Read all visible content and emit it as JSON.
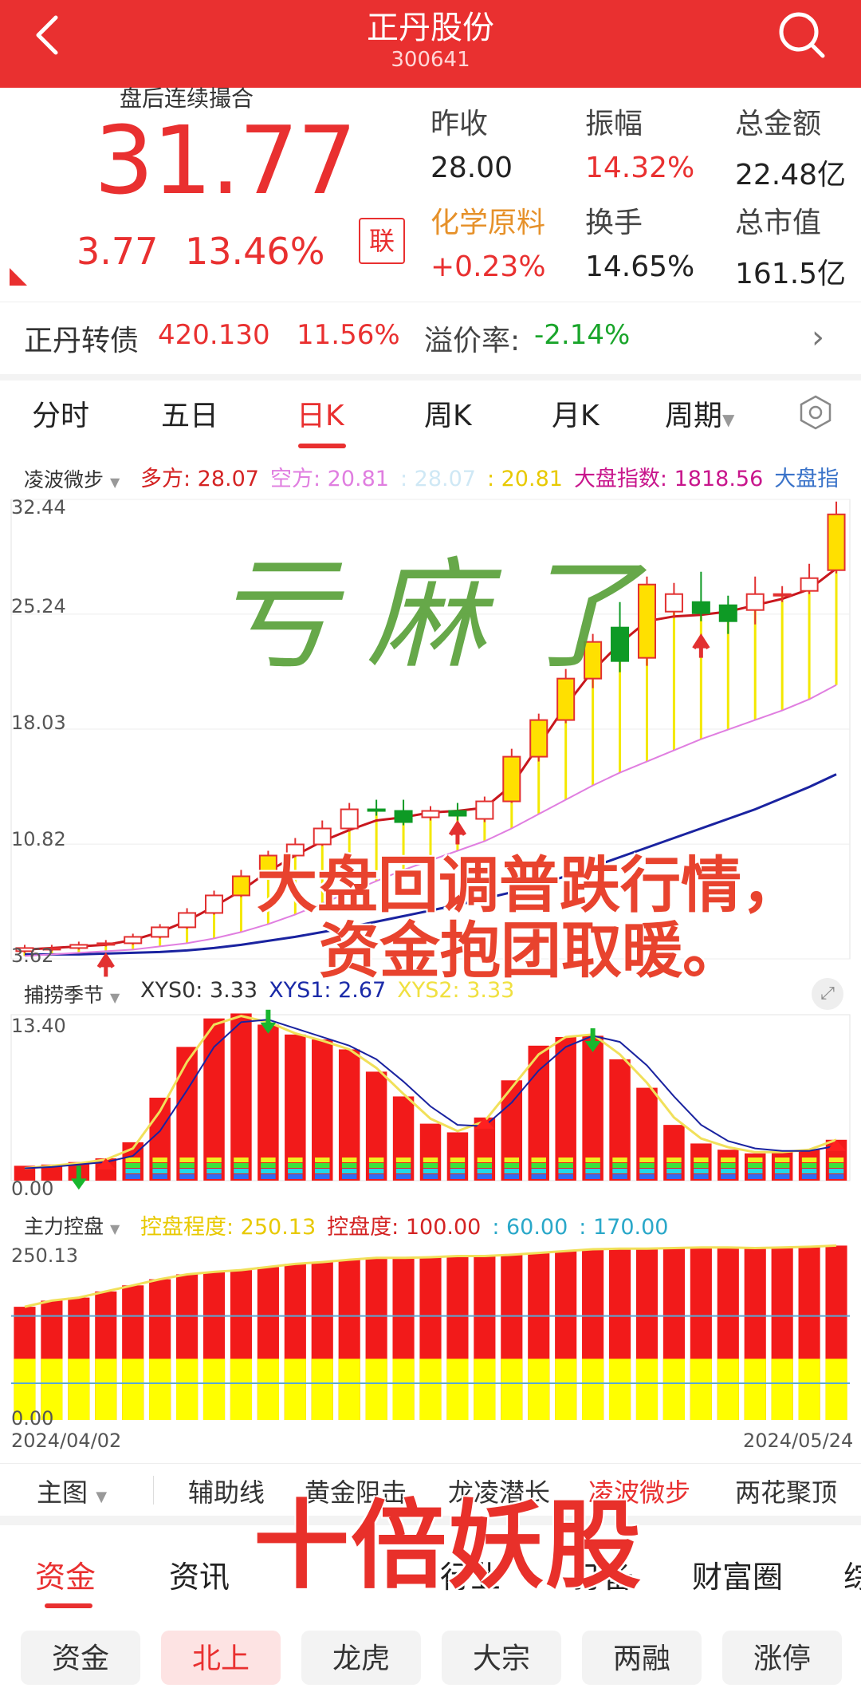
{
  "header": {
    "title": "正丹股份",
    "code": "300641"
  },
  "quote": {
    "status": "盘后连续撮合",
    "price": "31.77",
    "change": "3.77",
    "change_pct": "13.46%",
    "link_badge": "联",
    "fields": [
      {
        "label": "昨收",
        "value": "28.00",
        "color": "#222222"
      },
      {
        "label": "振幅",
        "value": "14.32%",
        "color": "#e93030"
      },
      {
        "label": "总金额",
        "value": "22.48亿",
        "color": "#222222"
      },
      {
        "label": "化学原料",
        "value": "+0.23%",
        "color": "#e93030"
      },
      {
        "label": "换手",
        "value": "14.65%",
        "color": "#222222"
      },
      {
        "label": "总市值",
        "value": "161.5亿",
        "color": "#222222"
      }
    ],
    "sector_label_color": "#e6912a"
  },
  "convertible": {
    "name": "正丹转债",
    "price": "420.130",
    "pct": "11.56%",
    "premium_label": "溢价率:",
    "premium_value": "-2.14%"
  },
  "period_tabs": [
    "分时",
    "五日",
    "日K",
    "周K",
    "月K",
    "周期"
  ],
  "main_indicator": {
    "name": "凌波微步",
    "items": [
      {
        "text": "多方: 28.07",
        "color": "#d42323"
      },
      {
        "text": "空方: 20.81",
        "color": "#e07ee0"
      },
      {
        "text": ": 28.07",
        "color": "#cfe8f5"
      },
      {
        "text": ": 20.81",
        "color": "#e8c900"
      },
      {
        "text": "大盘指数: 1818.56",
        "color": "#c8168c"
      },
      {
        "text": "大盘指",
        "color": "#3a73c9"
      }
    ]
  },
  "chart_data": [
    {
      "type": "candlestick",
      "title": "",
      "y_ticks": [
        "32.44",
        "25.24",
        "18.03",
        "10.82",
        "3.62"
      ],
      "ylim": [
        3.62,
        32.44
      ],
      "candles": [
        [
          4.1,
          4.3,
          4.5,
          4.0
        ],
        [
          4.3,
          4.3,
          4.5,
          4.1
        ],
        [
          4.3,
          4.5,
          4.7,
          4.2
        ],
        [
          4.5,
          4.6,
          4.8,
          4.4
        ],
        [
          4.6,
          5.0,
          5.2,
          4.5
        ],
        [
          5.0,
          5.6,
          5.8,
          4.9
        ],
        [
          5.6,
          6.5,
          6.8,
          5.5
        ],
        [
          6.5,
          7.6,
          7.9,
          6.4
        ],
        [
          7.6,
          8.8,
          9.2,
          7.5
        ],
        [
          8.8,
          10.1,
          10.4,
          8.6
        ],
        [
          10.1,
          10.8,
          11.2,
          10.0
        ],
        [
          10.8,
          11.8,
          12.3,
          10.7
        ],
        [
          11.8,
          13.0,
          13.4,
          11.6
        ],
        [
          13.0,
          12.9,
          13.6,
          12.6
        ],
        [
          12.9,
          12.2,
          13.6,
          12.0
        ],
        [
          12.5,
          12.9,
          13.2,
          12.3
        ],
        [
          12.9,
          12.6,
          13.4,
          12.3
        ],
        [
          12.4,
          13.5,
          13.8,
          12.2
        ],
        [
          13.5,
          16.3,
          16.8,
          13.4
        ],
        [
          16.3,
          18.6,
          19.0,
          16.0
        ],
        [
          18.6,
          21.2,
          21.8,
          18.4
        ],
        [
          21.2,
          23.5,
          24.0,
          20.6
        ],
        [
          24.4,
          22.3,
          26.0,
          21.6
        ],
        [
          22.5,
          27.1,
          27.6,
          22.0
        ],
        [
          25.4,
          26.5,
          27.2,
          25.0
        ],
        [
          26.0,
          25.3,
          27.9,
          24.8
        ],
        [
          25.8,
          24.8,
          26.4,
          24.0
        ],
        [
          25.5,
          26.5,
          27.6,
          24.6
        ],
        [
          26.5,
          26.5,
          27.0,
          26.0
        ],
        [
          26.7,
          27.5,
          28.4,
          26.5
        ],
        [
          28.0,
          31.5,
          32.3,
          27.8
        ]
      ],
      "red_line": [
        4.2,
        4.3,
        4.4,
        4.5,
        4.8,
        5.3,
        6.0,
        6.9,
        7.9,
        9.1,
        10.1,
        11.0,
        11.7,
        12.3,
        12.5,
        12.8,
        12.9,
        13.1,
        14.5,
        17.0,
        19.5,
        21.7,
        23.4,
        24.8,
        25.1,
        25.2,
        25.4,
        25.8,
        26.2,
        26.8,
        28.1
      ],
      "pink_line": [
        3.8,
        3.9,
        4.0,
        4.1,
        4.2,
        4.4,
        4.6,
        4.9,
        5.3,
        5.8,
        6.4,
        7.1,
        7.8,
        8.5,
        9.2,
        9.8,
        10.4,
        11.0,
        11.8,
        12.7,
        13.6,
        14.5,
        15.3,
        16.0,
        16.7,
        17.4,
        18.0,
        18.6,
        19.2,
        19.9,
        20.8
      ],
      "navy_line": [
        3.9,
        3.9,
        3.9,
        3.95,
        4.0,
        4.05,
        4.15,
        4.3,
        4.5,
        4.75,
        5.0,
        5.3,
        5.6,
        5.95,
        6.3,
        6.65,
        7.0,
        7.4,
        7.8,
        8.3,
        8.8,
        9.4,
        10.0,
        10.6,
        11.2,
        11.8,
        12.4,
        13.0,
        13.7,
        14.4,
        15.2
      ]
    },
    {
      "type": "bar",
      "title": "",
      "name": "捕捞季节",
      "labels": [
        {
          "text": "XYS0: 3.33",
          "color": "#333333"
        },
        {
          "text": "XYS1: 2.67",
          "color": "#1a2aa8"
        },
        {
          "text": "XYS2: 3.33",
          "color": "#f0e040"
        }
      ],
      "y_ticks": [
        "13.40",
        "0.00"
      ],
      "ylim": [
        0,
        13.4
      ],
      "values": [
        1.2,
        1.3,
        1.5,
        1.8,
        3.1,
        6.7,
        10.8,
        13.1,
        13.5,
        12.6,
        11.8,
        11.4,
        10.6,
        8.8,
        6.8,
        4.6,
        3.9,
        5.1,
        8.1,
        10.9,
        11.6,
        11.7,
        9.8,
        7.5,
        4.5,
        3.0,
        2.5,
        2.2,
        2.3,
        2.5,
        3.3
      ],
      "line_yellow": [
        1.0,
        1.2,
        1.4,
        1.7,
        2.6,
        5.6,
        9.6,
        12.6,
        13.3,
        12.8,
        11.9,
        11.3,
        10.6,
        9.1,
        7.0,
        5.0,
        4.0,
        4.8,
        7.5,
        10.2,
        11.6,
        11.8,
        10.2,
        7.9,
        5.1,
        3.4,
        2.7,
        2.3,
        2.3,
        2.5,
        3.3
      ],
      "line_navy": [
        1.0,
        1.1,
        1.3,
        1.5,
        2.0,
        4.0,
        7.3,
        10.8,
        12.8,
        13.0,
        12.3,
        11.6,
        10.9,
        9.8,
        8.0,
        6.0,
        4.5,
        4.4,
        6.3,
        8.9,
        10.8,
        11.7,
        11.2,
        9.3,
        6.8,
        4.5,
        3.2,
        2.6,
        2.4,
        2.4,
        2.8
      ]
    },
    {
      "type": "bar",
      "title": "",
      "name": "主力控盘",
      "labels": [
        {
          "text": "控盘程度: 250.13",
          "color": "#e8c900"
        },
        {
          "text": "控盘度: 100.00",
          "color": "#d42323"
        },
        {
          "text": ": 60.00",
          "color": "#2aa8c9"
        },
        {
          "text": ": 170.00",
          "color": "#2aa8c9"
        }
      ],
      "y_ticks": [
        "250.13",
        "0.00"
      ],
      "ylim": [
        0,
        250.13
      ],
      "values": [
        185,
        195,
        200,
        210,
        220,
        230,
        238,
        242,
        245,
        250,
        255,
        258,
        262,
        265,
        265,
        266,
        268,
        268,
        270,
        273,
        276,
        279,
        280,
        280,
        281,
        282,
        282,
        281,
        282,
        283,
        285
      ],
      "yellow_level": 100,
      "ref_lines": [
        60,
        170
      ]
    }
  ],
  "date_start": "2024/04/02",
  "date_end": "2024/05/24",
  "sub_tabs": [
    "主图",
    "辅助线",
    "黄金阻击",
    "龙凌潜长",
    "凌波微步",
    "两花聚顶"
  ],
  "info_tabs": [
    "资金",
    "资讯",
    "行业",
    "打备",
    "财富圈",
    "综"
  ],
  "pills": [
    "资金",
    "北上",
    "龙虎",
    "大宗",
    "两融",
    "涨停"
  ],
  "overlays": {
    "handwritten": "亏麻了",
    "line1": "大盘回调普跌行情，",
    "line2": "资金抱团取暖。",
    "banner": "十倍妖股"
  }
}
